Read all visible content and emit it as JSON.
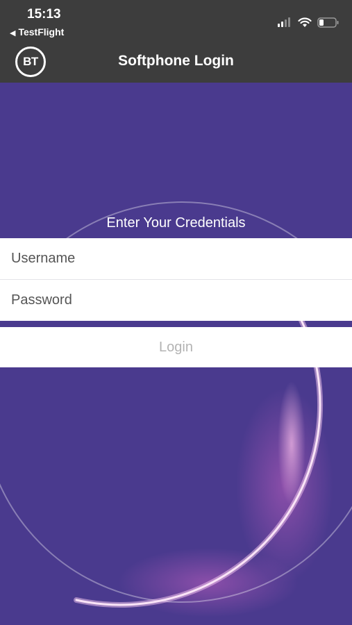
{
  "status_bar": {
    "time": "15:13",
    "back_app": "TestFlight",
    "icons": [
      "signal-icon",
      "wifi-icon",
      "battery-icon"
    ]
  },
  "nav": {
    "title": "Softphone Login",
    "logo_text": "BT"
  },
  "form": {
    "heading": "Enter Your Credentials",
    "username_placeholder": "Username",
    "password_placeholder": "Password",
    "login_label": "Login"
  },
  "colors": {
    "topbar": "#3d3d3d",
    "background": "#4a3a8e",
    "field": "#ffffff",
    "login_text_disabled": "#b3b3b3"
  }
}
